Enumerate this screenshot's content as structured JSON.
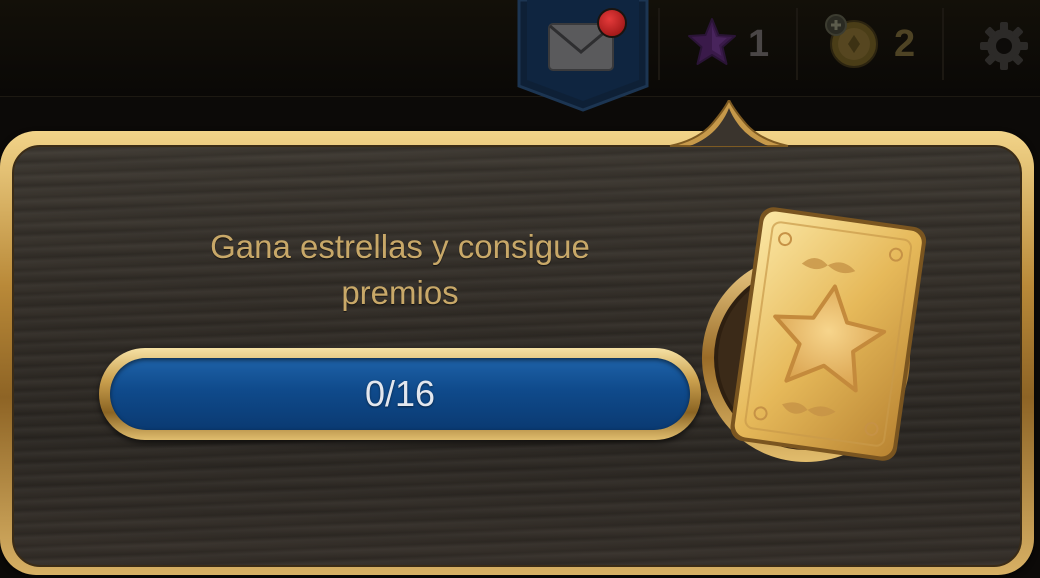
{
  "topbar": {
    "mail": {
      "icon": "envelope-icon",
      "has_notification": true
    },
    "stars": {
      "icon": "star-icon",
      "value": "1",
      "color": "#4a1f5a"
    },
    "coins": {
      "icon": "coin-plus-icon",
      "value": "2",
      "color": "#5a4a1c"
    },
    "settings": {
      "icon": "gear-icon"
    }
  },
  "panel": {
    "headline": "Gana estrellas y consigue premios",
    "progress": {
      "text": "0/16",
      "current": 0,
      "max": 16
    },
    "reward": {
      "icon": "star-card-icon"
    }
  }
}
